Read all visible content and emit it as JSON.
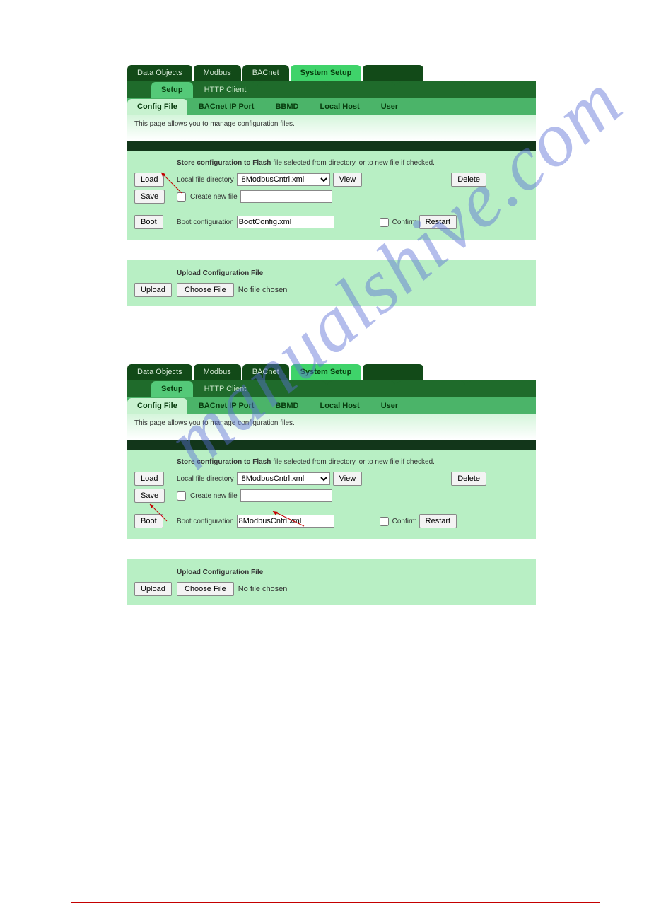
{
  "panels": [
    {
      "mainTabs": [
        "Data Objects",
        "Modbus",
        "BACnet",
        "System Setup"
      ],
      "mainActiveIndex": 3,
      "subTabs": [
        "Setup",
        "HTTP Client"
      ],
      "subActiveIndex": 0,
      "subSubTabs": [
        "Config File",
        "BACnet IP Port",
        "BBMD",
        "Local Host",
        "User"
      ],
      "subSubActiveIndex": 0,
      "infoText": "This page allows you to manage configuration files.",
      "storeLabelBold": "Store configuration to Flash",
      "storeLabelRest": " file selected from directory, or to new file if checked.",
      "loadBtn": "Load",
      "saveBtn": "Save",
      "bootBtn": "Boot",
      "localFileLabel": "Local file directory",
      "localFileSelected": "8ModbusCntrl.xml",
      "viewBtn": "View",
      "deleteBtn": "Delete",
      "createNewLabel": "Create new file",
      "newFileValue": "",
      "bootConfigLabel": "Boot configuration",
      "bootConfigValue": "BootConfig.xml",
      "confirmLabel": "Confirm",
      "restartBtn": "Restart",
      "uploadTitle": "Upload Configuration File",
      "uploadBtn": "Upload",
      "chooseFileBtn": "Choose File",
      "noFileText": "No file chosen"
    },
    {
      "mainTabs": [
        "Data Objects",
        "Modbus",
        "BACnet",
        "System Setup"
      ],
      "mainActiveIndex": 3,
      "subTabs": [
        "Setup",
        "HTTP Client"
      ],
      "subActiveIndex": 0,
      "subSubTabs": [
        "Config File",
        "BACnet IP Port",
        "BBMD",
        "Local Host",
        "User"
      ],
      "subSubActiveIndex": 0,
      "infoText": "This page allows you to manage configuration files.",
      "storeLabelBold": "Store configuration to Flash",
      "storeLabelRest": " file selected from directory, or to new file if checked.",
      "loadBtn": "Load",
      "saveBtn": "Save",
      "bootBtn": "Boot",
      "localFileLabel": "Local file directory",
      "localFileSelected": "8ModbusCntrl.xml",
      "viewBtn": "View",
      "deleteBtn": "Delete",
      "createNewLabel": "Create new file",
      "newFileValue": "",
      "bootConfigLabel": "Boot configuration",
      "bootConfigValue": "8ModbusCntrl.xml",
      "confirmLabel": "Confirm",
      "restartBtn": "Restart",
      "uploadTitle": "Upload Configuration File",
      "uploadBtn": "Upload",
      "chooseFileBtn": "Choose File",
      "noFileText": "No file chosen"
    }
  ],
  "watermark": "manualshive.com"
}
